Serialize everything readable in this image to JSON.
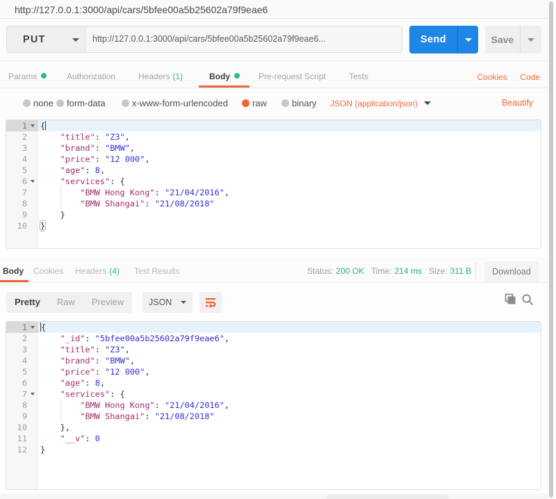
{
  "window": {
    "tab_title": "http://127.0.0.1:3000/api/cars/5bfee00a5b25602a79f9eae6"
  },
  "request": {
    "method": "PUT",
    "url": "http://127.0.0.1:3000/api/cars/5bfee00a5b25602a79f9eae6...",
    "send_label": "Send",
    "save_label": "Save",
    "tabs": [
      {
        "label": "Params",
        "dot": true
      },
      {
        "label": "Authorization"
      },
      {
        "label": "Headers",
        "count": "(1)"
      },
      {
        "label": "Body",
        "dot": true,
        "active": true
      },
      {
        "label": "Pre-request Script"
      },
      {
        "label": "Tests"
      }
    ],
    "links": {
      "cookies": "Cookies",
      "code": "Code"
    },
    "body_modes": [
      {
        "label": "none"
      },
      {
        "label": "form-data"
      },
      {
        "label": "x-www-form-urlencoded"
      },
      {
        "label": "raw",
        "selected": true
      },
      {
        "label": "binary"
      }
    ],
    "content_type": "JSON (application/json)",
    "beautify_label": "Beautify",
    "editor": {
      "lines": [
        [
          [
            "{",
            "p"
          ]
        ],
        [
          [
            "    ",
            "p"
          ],
          [
            "\"title\"",
            "k"
          ],
          [
            ": ",
            "p"
          ],
          [
            "\"Z3\"",
            "s"
          ],
          [
            ",",
            "p"
          ]
        ],
        [
          [
            "    ",
            "p"
          ],
          [
            "\"brand\"",
            "k"
          ],
          [
            ": ",
            "p"
          ],
          [
            "\"BMW\"",
            "s"
          ],
          [
            ",",
            "p"
          ]
        ],
        [
          [
            "    ",
            "p"
          ],
          [
            "\"price\"",
            "k"
          ],
          [
            ": ",
            "p"
          ],
          [
            "\"12 000\"",
            "s"
          ],
          [
            ",",
            "p"
          ]
        ],
        [
          [
            "    ",
            "p"
          ],
          [
            "\"age\"",
            "k"
          ],
          [
            ": ",
            "p"
          ],
          [
            "8",
            "n"
          ],
          [
            ",",
            "p"
          ]
        ],
        [
          [
            "    ",
            "p"
          ],
          [
            "\"services\"",
            "k"
          ],
          [
            ": {",
            "p"
          ]
        ],
        [
          [
            "        ",
            "p"
          ],
          [
            "\"BMW Hong Kong\"",
            "k"
          ],
          [
            ": ",
            "p"
          ],
          [
            "\"21/04/2016\"",
            "s"
          ],
          [
            ",",
            "p"
          ]
        ],
        [
          [
            "        ",
            "p"
          ],
          [
            "\"BMW Shangai\"",
            "k"
          ],
          [
            ": ",
            "p"
          ],
          [
            "\"21/08/2018\"",
            "s"
          ]
        ],
        [
          [
            "    }",
            "p"
          ]
        ],
        [
          [
            "}",
            "mb"
          ]
        ]
      ],
      "meta": {
        "active_line": 1,
        "folds": [
          1,
          6
        ],
        "cursor": {
          "line": 1,
          "ch": 1
        },
        "guide": {
          "col": 4,
          "from": 7,
          "to": 8
        }
      }
    }
  },
  "response": {
    "tabs": [
      {
        "label": "Body",
        "active": true
      },
      {
        "label": "Cookies"
      },
      {
        "label": "Headers",
        "count": "(4)"
      },
      {
        "label": "Test Results"
      }
    ],
    "status_items": [
      {
        "label": "Status:",
        "value": "200 OK"
      },
      {
        "label": "Time:",
        "value": "214 ms"
      },
      {
        "label": "Size:",
        "value": "311 B"
      }
    ],
    "download_label": "Download",
    "views": [
      {
        "label": "Pretty",
        "active": true
      },
      {
        "label": "Raw"
      },
      {
        "label": "Preview"
      }
    ],
    "format": "JSON",
    "editor": {
      "lines": [
        [
          [
            "{",
            "p"
          ]
        ],
        [
          [
            "    ",
            "p"
          ],
          [
            "\"_id\"",
            "k"
          ],
          [
            ": ",
            "p"
          ],
          [
            "\"5bfee00a5b25602a79f9eae6\"",
            "s"
          ],
          [
            ",",
            "p"
          ]
        ],
        [
          [
            "    ",
            "p"
          ],
          [
            "\"title\"",
            "k"
          ],
          [
            ": ",
            "p"
          ],
          [
            "\"Z3\"",
            "s"
          ],
          [
            ",",
            "p"
          ]
        ],
        [
          [
            "    ",
            "p"
          ],
          [
            "\"brand\"",
            "k"
          ],
          [
            ": ",
            "p"
          ],
          [
            "\"BMW\"",
            "s"
          ],
          [
            ",",
            "p"
          ]
        ],
        [
          [
            "    ",
            "p"
          ],
          [
            "\"price\"",
            "k"
          ],
          [
            ": ",
            "p"
          ],
          [
            "\"12 000\"",
            "s"
          ],
          [
            ",",
            "p"
          ]
        ],
        [
          [
            "    ",
            "p"
          ],
          [
            "\"age\"",
            "k"
          ],
          [
            ": ",
            "p"
          ],
          [
            "8",
            "n"
          ],
          [
            ",",
            "p"
          ]
        ],
        [
          [
            "    ",
            "p"
          ],
          [
            "\"services\"",
            "k"
          ],
          [
            ": {",
            "p"
          ]
        ],
        [
          [
            "        ",
            "p"
          ],
          [
            "\"BMW Hong Kong\"",
            "k"
          ],
          [
            ": ",
            "p"
          ],
          [
            "\"21/04/2016\"",
            "s"
          ],
          [
            ",",
            "p"
          ]
        ],
        [
          [
            "        ",
            "p"
          ],
          [
            "\"BMW Shangai\"",
            "k"
          ],
          [
            ": ",
            "p"
          ],
          [
            "\"21/08/2018\"",
            "s"
          ]
        ],
        [
          [
            "    },",
            "p"
          ]
        ],
        [
          [
            "    ",
            "p"
          ],
          [
            "\"__v\"",
            "k"
          ],
          [
            ": ",
            "p"
          ],
          [
            "0",
            "n"
          ]
        ],
        [
          [
            "}",
            "p"
          ]
        ]
      ],
      "meta": {
        "active_line": 1,
        "folds": [
          1,
          7
        ],
        "cursor": {
          "line": 1,
          "ch": 0
        },
        "guide": {
          "col": 4,
          "from": 8,
          "to": 9
        }
      }
    }
  },
  "colors": {
    "accent_orange": "#f0643b",
    "link_orange": "#ef6c3b",
    "green": "#2abd80",
    "send_blue": "#1f87e3",
    "code_key": "#a12d6e",
    "code_value": "#3330d8"
  }
}
